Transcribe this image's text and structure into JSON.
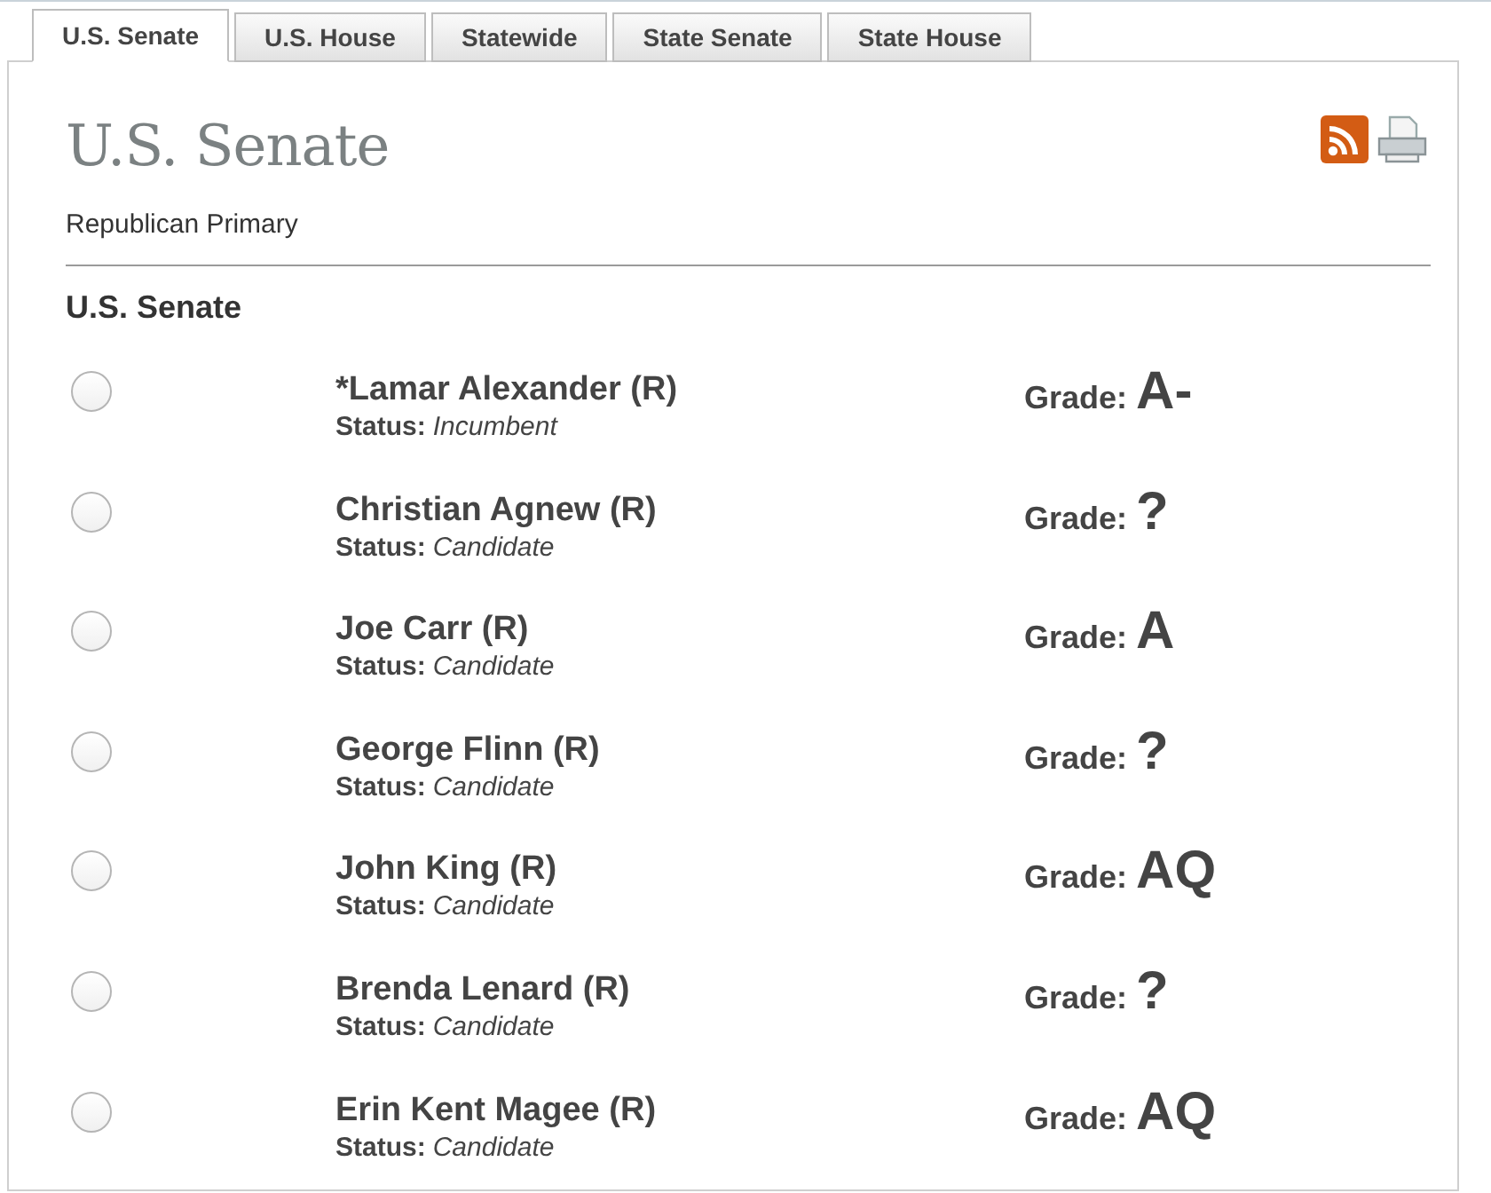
{
  "tabs": [
    {
      "label": "U.S. Senate",
      "selected": true
    },
    {
      "label": "U.S. House",
      "selected": false
    },
    {
      "label": "Statewide",
      "selected": false
    },
    {
      "label": "State Senate",
      "selected": false
    },
    {
      "label": "State House",
      "selected": false
    }
  ],
  "page_title": "U.S. Senate",
  "subtitle": "Republican Primary",
  "section_title": "U.S. Senate",
  "candidates": [
    {
      "name": "*Lamar Alexander (R)",
      "status_label": "Status:",
      "status": "Incumbent",
      "grade_label": "Grade:",
      "grade": "A-",
      "selected": false
    },
    {
      "name": "Christian Agnew (R)",
      "status_label": "Status:",
      "status": "Candidate",
      "grade_label": "Grade:",
      "grade": "?",
      "selected": false
    },
    {
      "name": "Joe Carr (R)",
      "status_label": "Status:",
      "status": "Candidate",
      "grade_label": "Grade:",
      "grade": "A",
      "selected": false
    },
    {
      "name": "George Flinn (R)",
      "status_label": "Status:",
      "status": "Candidate",
      "grade_label": "Grade:",
      "grade": "?",
      "selected": false
    },
    {
      "name": "John King (R)",
      "status_label": "Status:",
      "status": "Candidate",
      "grade_label": "Grade:",
      "grade": "AQ",
      "selected": false
    },
    {
      "name": "Brenda Lenard (R)",
      "status_label": "Status:",
      "status": "Candidate",
      "grade_label": "Grade:",
      "grade": "?",
      "selected": false
    },
    {
      "name": "Erin Kent Magee (R)",
      "status_label": "Status:",
      "status": "Candidate",
      "grade_label": "Grade:",
      "grade": "AQ",
      "selected": false
    }
  ]
}
